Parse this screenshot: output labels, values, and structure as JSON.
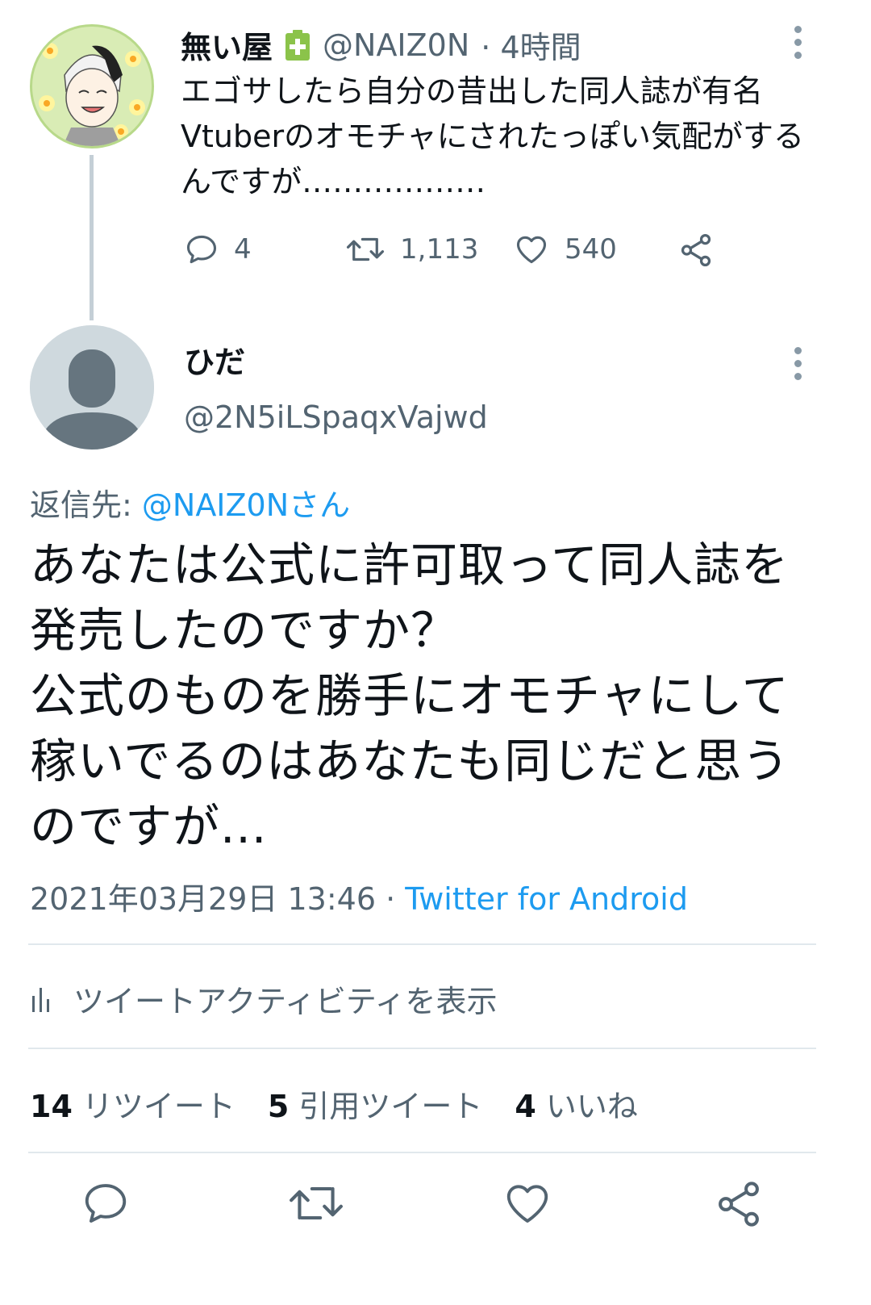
{
  "parent_tweet": {
    "name": "無い屋",
    "handle": "@NAIZ0N",
    "time": "· 4時間",
    "text": "エゴサしたら自分の昔出した同人誌が有名Vtuberのオモチャにされたっぽい気配がするんですが………………",
    "replies": "4",
    "retweets": "1,113",
    "likes": "540"
  },
  "reply_tweet": {
    "name": "ひだ",
    "handle": "@2N5iLSpaqxVajwd",
    "reply_to_label": "返信先: ",
    "reply_to_user": "@NAIZ0Nさん",
    "text": "あなたは公式に許可取って同人誌を発売したのですか？\n公式のものを勝手にオモチャにして稼いでるのはあなたも同じだと思うのですが...",
    "datetime": "2021年03月29日 13:46",
    "separator": " · ",
    "source": "Twitter for Android"
  },
  "activity": {
    "label": "ツイートアクティビティを表示"
  },
  "stats": {
    "retweets_count": "14",
    "retweets_label": "リツイート",
    "quotes_count": "5",
    "quotes_label": "引用ツイート",
    "likes_count": "4",
    "likes_label": "いいね"
  },
  "colors": {
    "link": "#1d9bf0",
    "secondary_text": "#536471",
    "icon": "#536471",
    "divider": "#e1e8ed"
  },
  "icons": [
    "reply-icon",
    "retweet-icon",
    "like-icon",
    "share-icon",
    "more-icon",
    "chart-icon"
  ]
}
